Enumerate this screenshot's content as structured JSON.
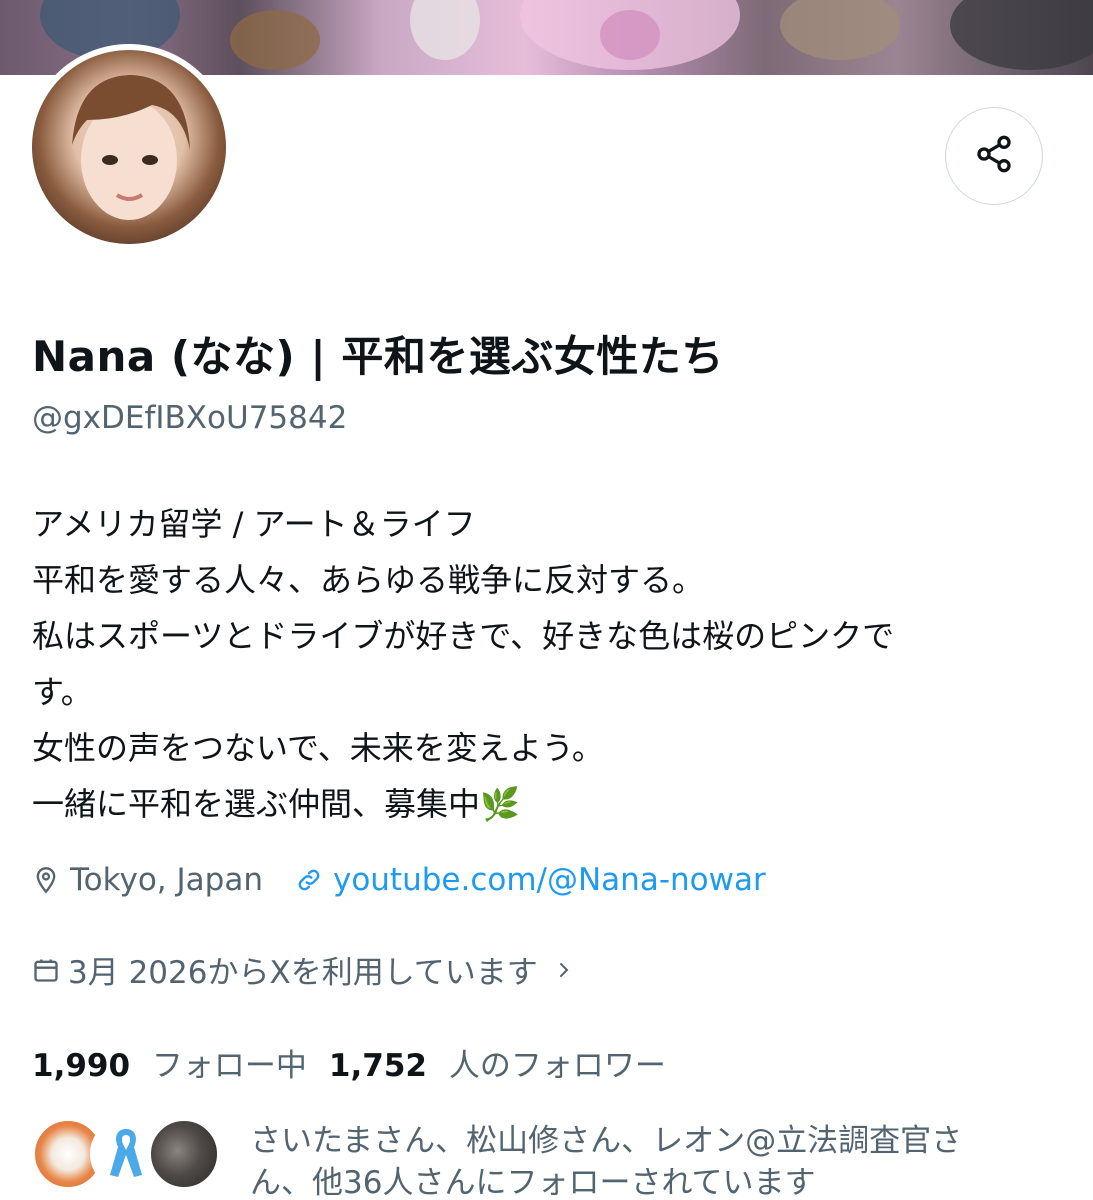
{
  "profile": {
    "display_name": "Nana (なな) | 平和を選ぶ女性たち",
    "handle": "@gxDEfIBXoU75842",
    "bio_lines": [
      "アメリカ留学 / アート＆ライフ",
      "平和を愛する人々、あらゆる戦争に反対する。",
      "私はスポーツとドライブが好きで、好きな色は桜のピンクで",
      "す。",
      "女性の声をつないで、未来を変えよう。",
      "一緒に平和を選ぶ仲間、募集中🌿"
    ],
    "location": "Tokyo, Japan",
    "website": "youtube.com/@Nana-nowar",
    "joined": "3月 2026からXを利用しています",
    "following_count": "1,990",
    "following_label": "フォロー中",
    "followers_count": "1,752",
    "followers_label": "人のフォロワー",
    "known_followers_lines": [
      "さいたまさん、松山修さん、レオン@立法調査官さ",
      "ん、他36人さんにフォローされています"
    ]
  },
  "icons": {
    "share": "share-icon",
    "location": "location-pin-icon",
    "link": "link-icon",
    "calendar": "calendar-icon",
    "chevron": "chevron-right-icon"
  },
  "colors": {
    "primary_text": "#0f1419",
    "secondary_text": "#536471",
    "link": "#1d9bf0",
    "border": "#cfd9de"
  }
}
